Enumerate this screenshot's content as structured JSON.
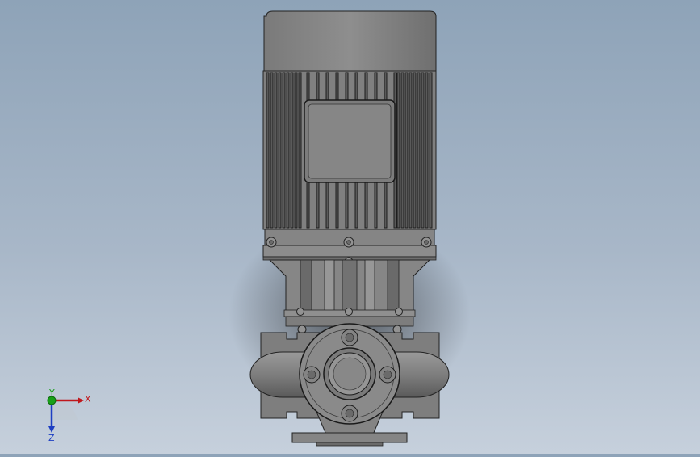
{
  "viewport": {
    "background_top": "#8ea3b8",
    "background_bottom": "#c6d0dc",
    "model": {
      "body_color": "#8a8a8a",
      "dark_color": "#5e5e5e",
      "light_color": "#a8a8a8",
      "edge_color": "#1a1a1a"
    }
  },
  "triad": {
    "x_label": "X",
    "y_label": "Y",
    "z_label": "Z",
    "x_color": "#c0171c",
    "y_color": "#18a018",
    "z_color": "#1d3ec2"
  }
}
